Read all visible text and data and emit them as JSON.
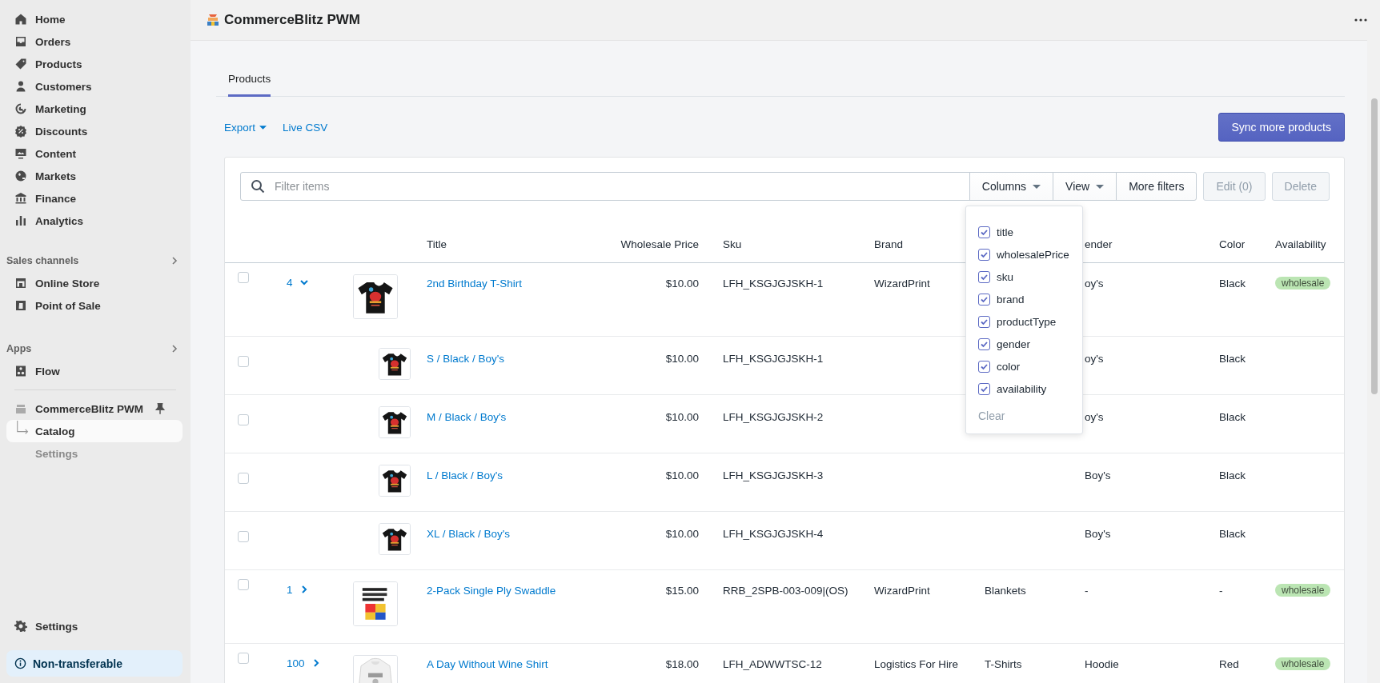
{
  "sidebar": {
    "nav": [
      {
        "label": "Home",
        "selected": false
      },
      {
        "label": "Orders",
        "selected": false
      },
      {
        "label": "Products",
        "selected": false
      },
      {
        "label": "Customers",
        "selected": false
      },
      {
        "label": "Marketing",
        "selected": false
      },
      {
        "label": "Discounts",
        "selected": false
      },
      {
        "label": "Content",
        "selected": false
      },
      {
        "label": "Markets",
        "selected": false
      },
      {
        "label": "Finance",
        "selected": false
      },
      {
        "label": "Analytics",
        "selected": false
      }
    ],
    "sections": [
      {
        "title": "Sales channels",
        "items": [
          {
            "label": "Online Store",
            "selected": false
          },
          {
            "label": "Point of Sale",
            "selected": false
          }
        ]
      },
      {
        "title": "Apps",
        "items": [
          {
            "label": "Flow",
            "selected": false
          }
        ]
      }
    ],
    "app": {
      "label": "CommerceBlitz PWM",
      "children": [
        {
          "label": "Catalog",
          "selected": true
        },
        {
          "label": "Settings",
          "selected": false
        }
      ]
    },
    "footer": {
      "label": "Settings"
    },
    "badge": "Non-transferable"
  },
  "header": {
    "title": "CommerceBlitz PWM"
  },
  "tabs": [
    {
      "label": "Products",
      "selected": true
    }
  ],
  "actions": {
    "export": "Export",
    "live_csv": "Live CSV",
    "sync": "Sync more products"
  },
  "toolbar": {
    "search": {
      "placeholder": "Filter items"
    },
    "buttons": [
      {
        "label": "Columns",
        "kind": "menu",
        "disabled": false
      },
      {
        "label": "View",
        "kind": "menu",
        "disabled": false
      },
      {
        "label": "More filters",
        "kind": "plain",
        "disabled": false
      },
      {
        "label": "Edit (0)",
        "kind": "action",
        "disabled": true
      },
      {
        "label": "Delete",
        "kind": "action",
        "disabled": true
      }
    ]
  },
  "table": {
    "columns": [
      null,
      null,
      null,
      "Title",
      "Wholesale Price",
      "Sku",
      "Brand",
      null,
      "ender",
      "Color",
      "Availability"
    ],
    "rows": [
      {
        "kind": "product",
        "checked": false,
        "count": "4",
        "expanded": true,
        "title": "2nd Birthday T-Shirt",
        "price": "$10.00",
        "sku": "LFH_KSGJGJSKH-1",
        "brand": "WizardPrint",
        "gender": "oy's",
        "color_name": "Black",
        "availability": "wholesale"
      },
      {
        "kind": "variant",
        "checked": false,
        "title": "S / Black / Boy's",
        "price": "$10.00",
        "sku": "LFH_KSGJGJSKH-1",
        "gender": "oy's",
        "color_name": "Black"
      },
      {
        "kind": "variant",
        "checked": false,
        "title": "M / Black / Boy's",
        "price": "$10.00",
        "sku": "LFH_KSGJGJSKH-2",
        "gender": "oy's",
        "color_name": "Black"
      },
      {
        "kind": "variant",
        "checked": false,
        "title": "L / Black / Boy's",
        "price": "$10.00",
        "sku": "LFH_KSGJGJSKH-3",
        "gender": "Boy's",
        "color_name": "Black"
      },
      {
        "kind": "variant",
        "checked": false,
        "title": "XL / Black / Boy's",
        "price": "$10.00",
        "sku": "LFH_KSGJGJSKH-4",
        "gender": "Boy's",
        "color_name": "Black"
      },
      {
        "kind": "product",
        "checked": false,
        "count": "1",
        "expanded": false,
        "title": "2-Pack Single Ply Swaddle",
        "price": "$15.00",
        "sku": "RRB_2SPB-003-009|(OS)",
        "brand": "WizardPrint",
        "product_type": "Blankets",
        "gender": "-",
        "color_name": "-",
        "availability": "wholesale"
      },
      {
        "kind": "product",
        "checked": false,
        "count": "100",
        "expanded": false,
        "title": "A Day Without Wine Shirt",
        "price": "$18.00",
        "sku": "LFH_ADWWTSC-12",
        "brand": "Logistics For Hire",
        "product_type": "T-Shirts",
        "gender": "Hoodie",
        "color_name": "Red",
        "availability": "wholesale"
      }
    ]
  },
  "columns_menu": {
    "items": [
      {
        "label": "title",
        "checked": true
      },
      {
        "label": "wholesalePrice",
        "checked": true
      },
      {
        "label": "sku",
        "checked": true
      },
      {
        "label": "brand",
        "checked": true
      },
      {
        "label": "productType",
        "checked": true
      },
      {
        "label": "gender",
        "checked": true
      },
      {
        "label": "color",
        "checked": true
      },
      {
        "label": "availability",
        "checked": true
      }
    ],
    "clear": "Clear"
  }
}
